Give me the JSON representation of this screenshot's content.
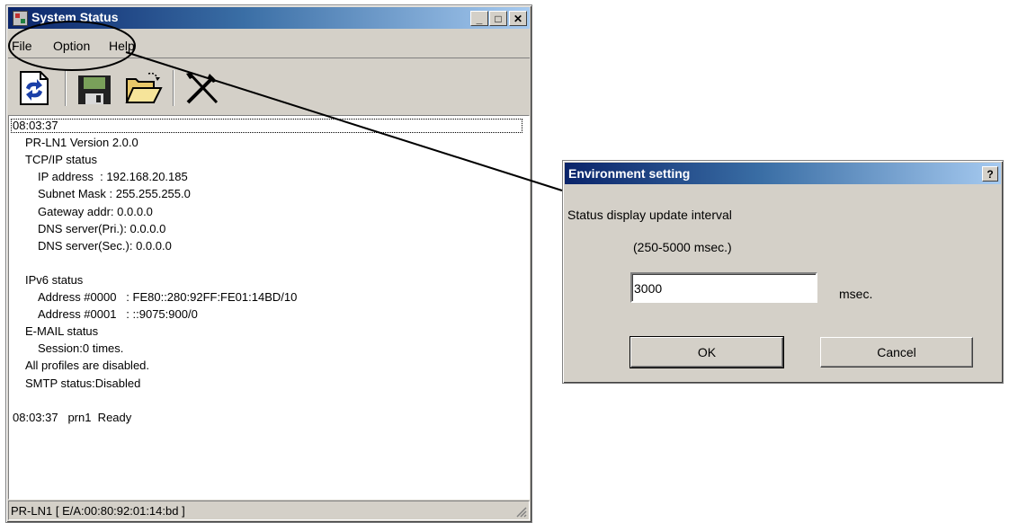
{
  "main_window": {
    "title": "System Status",
    "menu": [
      "File",
      "Option",
      "Help"
    ],
    "toolbar_icons": [
      "refresh-icon",
      "save-icon",
      "open-folder-icon",
      "tools-icon"
    ],
    "log_lines": [
      {
        "text": "08:03:37",
        "indent": 0
      },
      {
        "text": "PR-LN1 Version 2.0.0",
        "indent": 1
      },
      {
        "text": "TCP/IP status",
        "indent": 1
      },
      {
        "text": "IP address  : 192.168.20.185",
        "indent": 2
      },
      {
        "text": "Subnet Mask : 255.255.255.0",
        "indent": 2
      },
      {
        "text": "Gateway addr: 0.0.0.0",
        "indent": 2
      },
      {
        "text": "DNS server(Pri.): 0.0.0.0",
        "indent": 2
      },
      {
        "text": "DNS server(Sec.): 0.0.0.0",
        "indent": 2
      },
      {
        "text": "",
        "indent": 0
      },
      {
        "text": "IPv6 status",
        "indent": 1
      },
      {
        "text": "Address #0000   : FE80::280:92FF:FE01:14BD/10",
        "indent": 2
      },
      {
        "text": "Address #0001   : ::9075:900/0",
        "indent": 2
      },
      {
        "text": "E-MAIL status",
        "indent": 1
      },
      {
        "text": "Session:0 times.",
        "indent": 2
      },
      {
        "text": "All profiles are disabled.",
        "indent": 1
      },
      {
        "text": "SMTP status:Disabled",
        "indent": 1
      },
      {
        "text": "",
        "indent": 0
      },
      {
        "text": "08:03:37   prn1  Ready",
        "indent": 0
      }
    ],
    "status_bar": "PR-LN1 [ E/A:00:80:92:01:14:bd ]",
    "controls": {
      "minimize": "_",
      "maximize": "□",
      "close": "✕"
    }
  },
  "dialog": {
    "title": "Environment setting",
    "help_button": "?",
    "label_interval": "Status display update interval",
    "label_range": "(250-5000 msec.)",
    "interval_value": "3000",
    "unit_label": "msec.",
    "ok_label": "OK",
    "cancel_label": "Cancel"
  }
}
